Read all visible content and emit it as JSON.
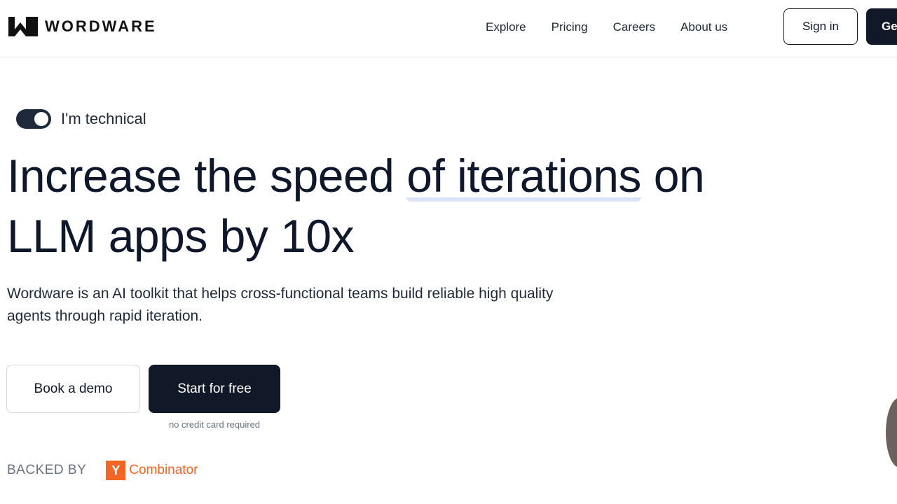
{
  "header": {
    "logo_text": "WORDWARE",
    "nav": [
      "Explore",
      "Pricing",
      "Careers",
      "About us"
    ],
    "signin_label": "Sign in",
    "cta_label": "Get started"
  },
  "toggle": {
    "label": "I'm technical",
    "on": true
  },
  "hero": {
    "title_part1": "Increase the speed ",
    "title_highlight": "of iterations",
    "title_part2": " on LLM apps by 10x",
    "subtitle": "Wordware is an AI toolkit that helps cross-functional teams build reliable high quality agents through rapid iteration."
  },
  "cta": {
    "demo_label": "Book a demo",
    "start_label": "Start for free",
    "note": "no credit card required"
  },
  "backed": {
    "label": "BACKED BY",
    "yc_letter": "Y",
    "yc_name": "Combinator"
  },
  "colors": {
    "primary_dark": "#111827",
    "highlight": "#dbe4f5",
    "yc_orange": "#f26522"
  },
  "icons": {
    "logo": "wordware-w-logo-icon"
  }
}
